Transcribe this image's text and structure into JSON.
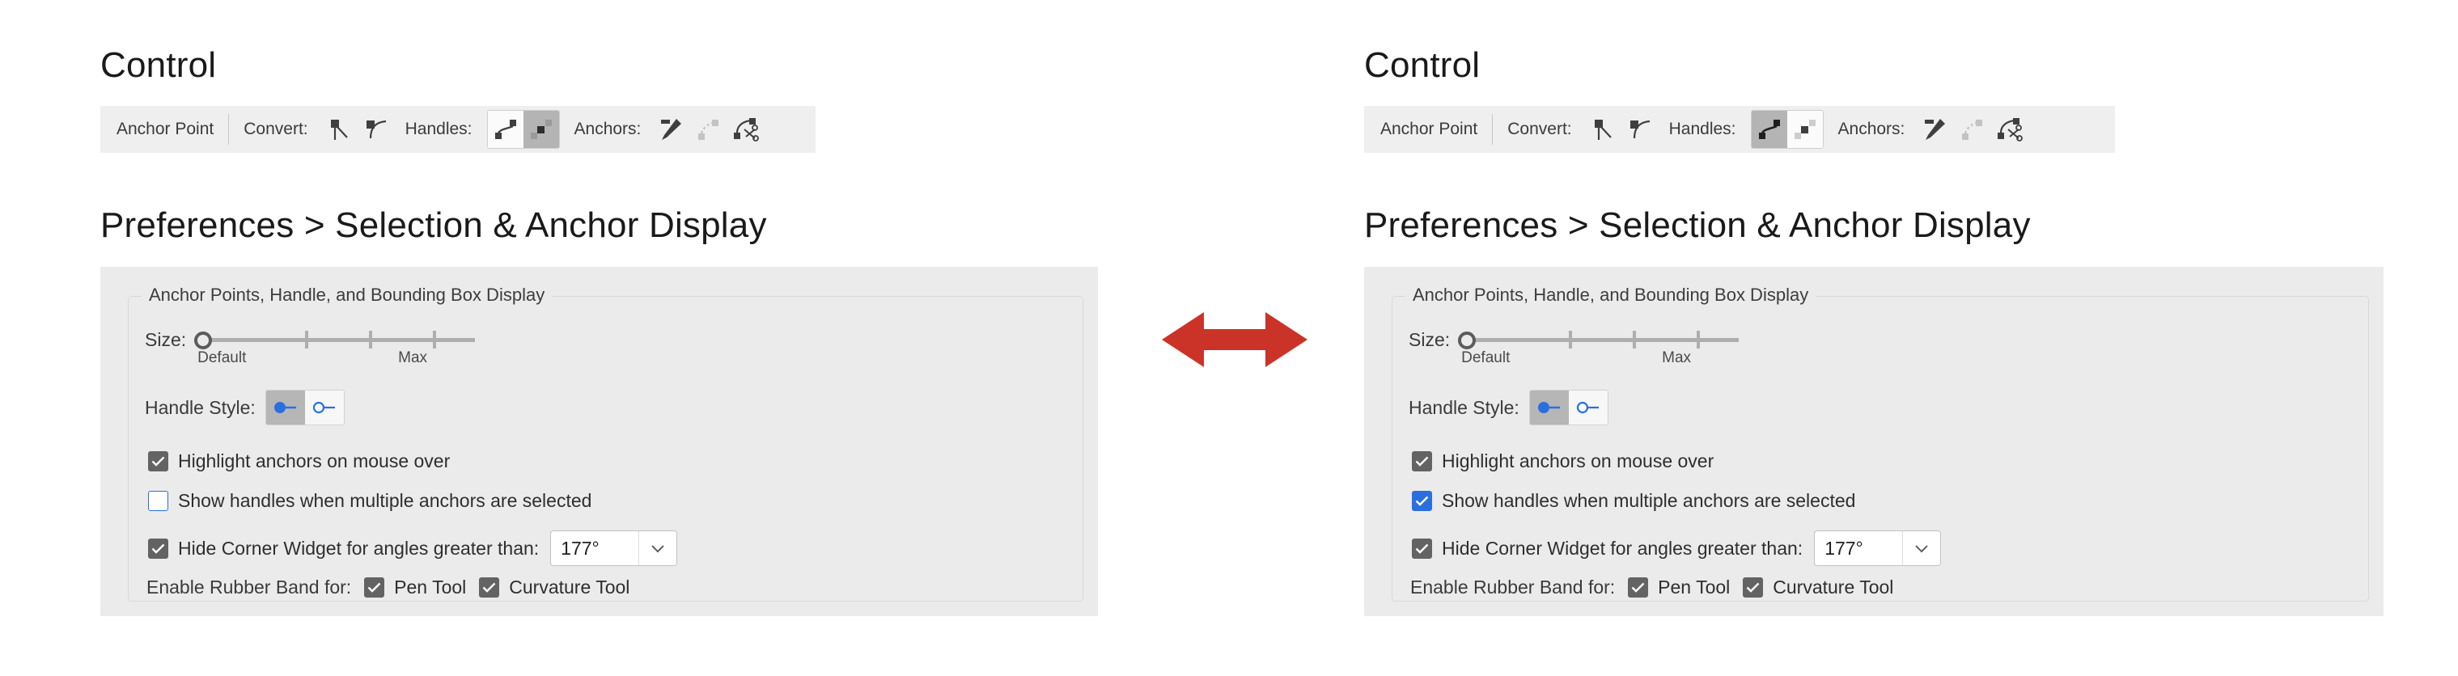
{
  "colors": {
    "arrow_red": "#cc3328",
    "panel_bg": "#ebebeb",
    "controlbar_bg": "#efefef",
    "accent_blue": "#2a6fe0",
    "checkbox_gray": "#636363"
  },
  "panels": [
    {
      "id": "left",
      "control_heading": "Control",
      "control_bar": {
        "tool_name": "Anchor Point",
        "convert_label": "Convert:",
        "convert_icons": [
          "convert-to-corner-icon",
          "convert-to-smooth-icon"
        ],
        "handles_label": "Handles:",
        "handles_icons": [
          "show-handles-icon",
          "hide-handles-icon"
        ],
        "handles_selected_index": 1,
        "anchors_label": "Anchors:",
        "anchors_icons": [
          "pen-tool-icon",
          "remove-anchor-icon",
          "cut-path-icon"
        ]
      },
      "prefs_heading": "Preferences > Selection & Anchor Display",
      "prefs": {
        "legend": "Anchor Points, Handle, and Bounding Box Display",
        "size_label": "Size:",
        "size_scale_min": "Default",
        "size_scale_max": "Max",
        "size_value_position": 0,
        "handle_style_label": "Handle Style:",
        "handle_style_options": [
          "filled-handle-icon",
          "hollow-handle-icon"
        ],
        "handle_style_selected_index": 0,
        "checkboxes": [
          {
            "label": "Highlight anchors on mouse over",
            "checked": true,
            "style": "gray"
          },
          {
            "label": "Show handles when multiple anchors are selected",
            "checked": false,
            "style": "outline"
          },
          {
            "label": "Hide Corner Widget for angles greater than:",
            "checked": true,
            "style": "gray"
          }
        ],
        "angle_value": "177°",
        "rubber_band_label": "Enable Rubber Band for:",
        "rubber_band_options": [
          {
            "label": "Pen Tool",
            "checked": true
          },
          {
            "label": "Curvature Tool",
            "checked": true
          }
        ]
      }
    },
    {
      "id": "right",
      "control_heading": "Control",
      "control_bar": {
        "tool_name": "Anchor Point",
        "convert_label": "Convert:",
        "convert_icons": [
          "convert-to-corner-icon",
          "convert-to-smooth-icon"
        ],
        "handles_label": "Handles:",
        "handles_icons": [
          "show-handles-icon",
          "hide-handles-icon"
        ],
        "handles_selected_index": 0,
        "anchors_label": "Anchors:",
        "anchors_icons": [
          "pen-tool-icon",
          "remove-anchor-icon",
          "cut-path-icon"
        ]
      },
      "prefs_heading": "Preferences > Selection & Anchor Display",
      "prefs": {
        "legend": "Anchor Points, Handle, and Bounding Box Display",
        "size_label": "Size:",
        "size_scale_min": "Default",
        "size_scale_max": "Max",
        "size_value_position": 0,
        "handle_style_label": "Handle Style:",
        "handle_style_options": [
          "filled-handle-icon",
          "hollow-handle-icon"
        ],
        "handle_style_selected_index": 0,
        "checkboxes": [
          {
            "label": "Highlight anchors on mouse over",
            "checked": true,
            "style": "gray"
          },
          {
            "label": "Show handles when multiple anchors are selected",
            "checked": true,
            "style": "blue"
          },
          {
            "label": "Hide Corner Widget for angles greater than:",
            "checked": true,
            "style": "gray"
          }
        ],
        "angle_value": "177°",
        "rubber_band_label": "Enable Rubber Band for:",
        "rubber_band_options": [
          {
            "label": "Pen Tool",
            "checked": true
          },
          {
            "label": "Curvature Tool",
            "checked": true
          }
        ]
      }
    }
  ],
  "comparison_arrow": {
    "name": "double-headed-arrow",
    "direction": "left-right"
  }
}
